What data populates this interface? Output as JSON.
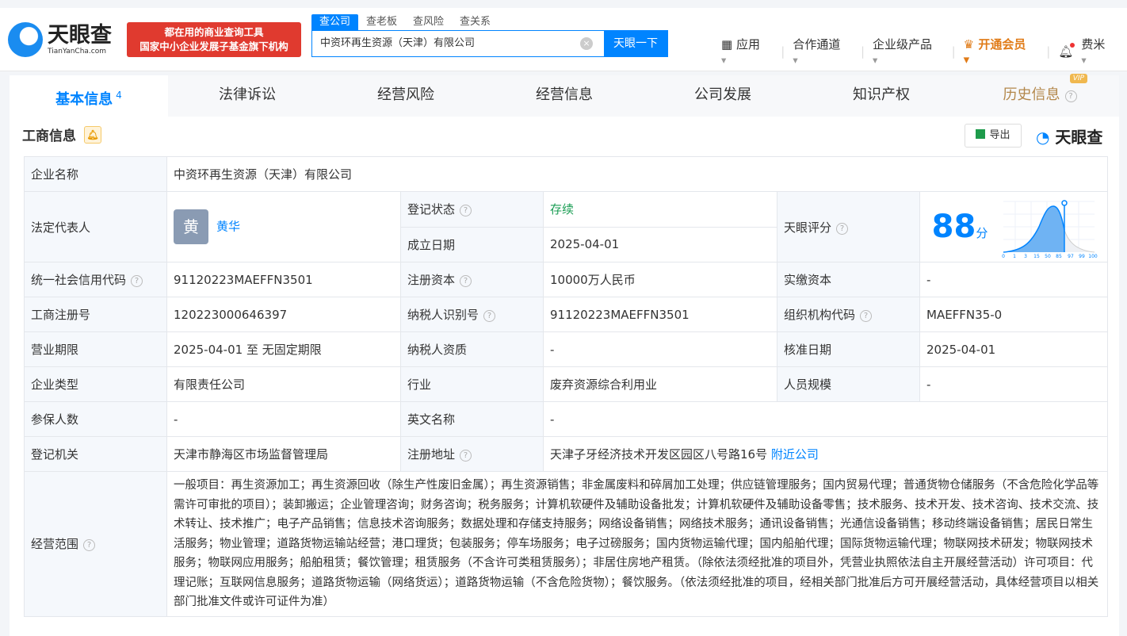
{
  "header": {
    "logo_text": "天眼查",
    "logo_domain": "TianYanCha.com",
    "slogan_line1": "都在用的商业查询工具",
    "slogan_line2": "国家中小企业发展子基金旗下机构",
    "search_tabs": [
      "查公司",
      "查老板",
      "查风险",
      "查关系"
    ],
    "search_value": "中资环再生资源（天津）有限公司",
    "search_button": "天眼一下",
    "nav": [
      "应用",
      "合作通道",
      "企业级产品",
      "开通会员",
      "费米"
    ]
  },
  "tabs": [
    {
      "label": "基本信息",
      "count": "4"
    },
    {
      "label": "法律诉讼"
    },
    {
      "label": "经营风险"
    },
    {
      "label": "经营信息"
    },
    {
      "label": "公司发展"
    },
    {
      "label": "知识产权"
    },
    {
      "label": "历史信息",
      "badge": "VIP"
    }
  ],
  "section": {
    "title": "工商信息",
    "export": "导出",
    "brand": "天眼查"
  },
  "info": {
    "company_name_label": "企业名称",
    "company_name": "中资环再生资源（天津）有限公司",
    "legal_rep_label": "法定代表人",
    "legal_rep_avatar": "黄",
    "legal_rep": "黄华",
    "status_label": "登记状态",
    "status": "存续",
    "founded_label": "成立日期",
    "founded": "2025-04-01",
    "score_label": "天眼评分",
    "score": "88",
    "score_unit": "分",
    "score_ticks": [
      "0",
      "1",
      "3",
      "15",
      "50",
      "85",
      "97",
      "99",
      "100"
    ],
    "credit_code_label": "统一社会信用代码",
    "credit_code": "91120223MAEFFN3501",
    "reg_capital_label": "注册资本",
    "reg_capital": "10000万人民币",
    "paid_capital_label": "实缴资本",
    "paid_capital": "-",
    "reg_no_label": "工商注册号",
    "reg_no": "120223000646397",
    "taxpayer_id_label": "纳税人识别号",
    "taxpayer_id": "91120223MAEFFN3501",
    "org_code_label": "组织机构代码",
    "org_code": "MAEFFN35-0",
    "term_label": "营业期限",
    "term": "2025-04-01 至 无固定期限",
    "taxpayer_q_label": "纳税人资质",
    "taxpayer_q": "-",
    "approve_label": "核准日期",
    "approve": "2025-04-01",
    "type_label": "企业类型",
    "type": "有限责任公司",
    "industry_label": "行业",
    "industry": "废弃资源综合利用业",
    "staff_label": "人员规模",
    "staff": "-",
    "insured_label": "参保人数",
    "insured": "-",
    "en_name_label": "英文名称",
    "en_name": "-",
    "authority_label": "登记机关",
    "authority": "天津市静海区市场监督管理局",
    "address_label": "注册地址",
    "address": "天津子牙经济技术开发区园区八号路16号",
    "nearby": "附近公司",
    "scope_label": "经营范围",
    "scope": "一般项目：再生资源加工；再生资源回收（除生产性废旧金属）；再生资源销售；非金属废料和碎屑加工处理；供应链管理服务；国内贸易代理；普通货物仓储服务（不含危险化学品等需许可审批的项目）；装卸搬运；企业管理咨询；财务咨询；税务服务；计算机软硬件及辅助设备批发；计算机软硬件及辅助设备零售；技术服务、技术开发、技术咨询、技术交流、技术转让、技术推广；电子产品销售；信息技术咨询服务；数据处理和存储支持服务；网络设备销售；网络技术服务；通讯设备销售；光通信设备销售；移动终端设备销售；居民日常生活服务；物业管理；道路货物运输站经营；港口理货；包装服务；停车场服务；电子过磅服务；国内货物运输代理；国内船舶代理；国际货物运输代理；物联网技术研发；物联网技术服务；物联网应用服务；船舶租赁；餐饮管理；租赁服务（不含许可类租赁服务）；非居住房地产租赁。（除依法须经批准的项目外，凭营业执照依法自主开展经营活动）许可项目：代理记账；互联网信息服务；道路货物运输（网络货运）；道路货物运输（不含危险货物）；餐饮服务。（依法须经批准的项目，经相关部门批准后方可开展经营活动，具体经营项目以相关部门批准文件或许可证件为准）"
  }
}
